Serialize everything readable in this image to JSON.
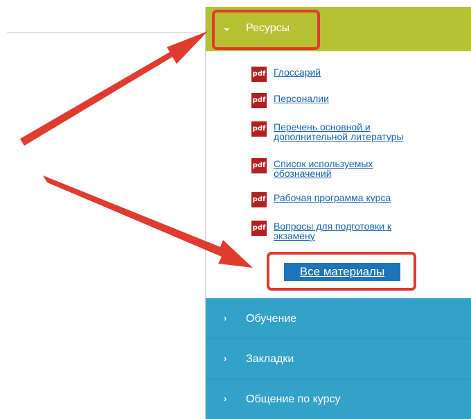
{
  "accordion": {
    "open_section": {
      "label": "Ресурсы",
      "chevron": "chevron-down-icon"
    },
    "links": [
      {
        "icon": "pdf-icon",
        "label": "Глоссарий"
      },
      {
        "icon": "pdf-icon",
        "label": "Персоналии"
      },
      {
        "icon": "pdf-icon",
        "label": "Перечень основной и дополнительной литературы"
      },
      {
        "icon": "pdf-icon",
        "label": "Список используемых обозначений"
      },
      {
        "icon": "pdf-icon",
        "label": "Рабочая программа курса"
      },
      {
        "icon": "pdf-icon",
        "label": "Вопросы для подготовки к экзамену"
      }
    ],
    "pdf_badge": "pdf",
    "all_materials_label": "Все материалы",
    "sections": [
      {
        "label": "Обучение",
        "chevron": "chevron-right-icon"
      },
      {
        "label": "Закладки",
        "chevron": "chevron-right-icon"
      },
      {
        "label": "Общение по курсу",
        "chevron": "chevron-right-icon"
      }
    ]
  },
  "colors": {
    "open_header": "#b5c133",
    "section_header": "#32a2c9",
    "link": "#1a66b5",
    "button": "#1f73b7",
    "annotation": "#e03b2f"
  }
}
